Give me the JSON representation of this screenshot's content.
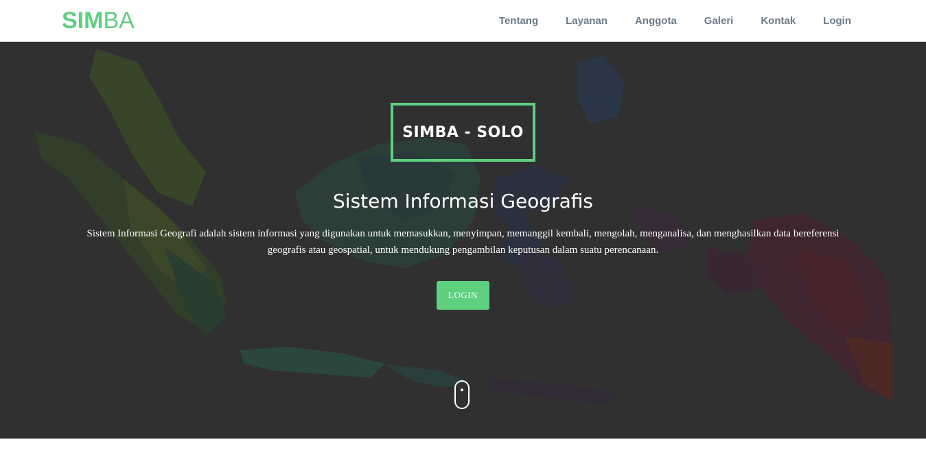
{
  "brand": {
    "part1": "SIM",
    "part2": "BA",
    "color": "#5fcf80"
  },
  "nav": {
    "items": [
      {
        "label": "Tentang"
      },
      {
        "label": "Layanan"
      },
      {
        "label": "Anggota"
      },
      {
        "label": "Galeri"
      },
      {
        "label": "Kontak"
      },
      {
        "label": "Login"
      }
    ]
  },
  "hero": {
    "title_box": "SIMBA - SOLO",
    "heading": "Sistem Informasi Geografis",
    "description": "Sistem Informasi Geografi adalah sistem informasi yang digunakan untuk memasukkan, menyimpan, memanggil kembali, mengolah, menganalisa, dan menghasilkan data bereferensi geografis atau geospatial, untuk mendukung pengambilan keputusan dalam suatu perencanaan.",
    "login_button": "LOGIN",
    "accent_color": "#5fcf80",
    "scroll_indicator_icon": "mouse-scroll-icon"
  }
}
